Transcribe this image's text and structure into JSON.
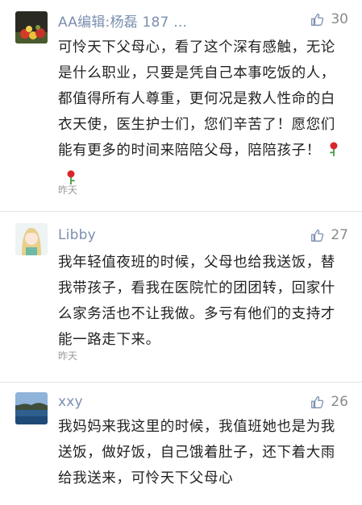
{
  "comments": [
    {
      "username": "AA编辑:杨磊 187 …",
      "likes": "30",
      "text": "可怜天下父母心，看了这个深有感触，无论是什么职业，只要是凭自己本事吃饭的人，都值得所有人尊重，更何况是救人性命的白衣天使，医生护士们，您们辛苦了！愿您们能有更多的时间来陪陪父母，陪陪孩子！",
      "time": "昨天"
    },
    {
      "username": "Libby",
      "likes": "27",
      "text": "我年轻值夜班的时候，父母也给我送饭，替我带孩子，看我在医院忙的团团转，回家什么家务活也不让我做。多亏有他们的支持才能一路走下来。",
      "time": "昨天"
    },
    {
      "username": "xxy",
      "likes": "26",
      "text": "我妈妈来我这里的时候，我值班她也是为我送饭，做好饭，自己饿着肚子，还下着大雨给我送来，可怜天下父母心",
      "time": ""
    }
  ],
  "icons": {
    "like": "thumbs-up-icon",
    "emoji": "rose-icon"
  },
  "colors": {
    "username": "#7b8fb0",
    "body_text": "#222222",
    "meta": "#9a9a9a"
  }
}
